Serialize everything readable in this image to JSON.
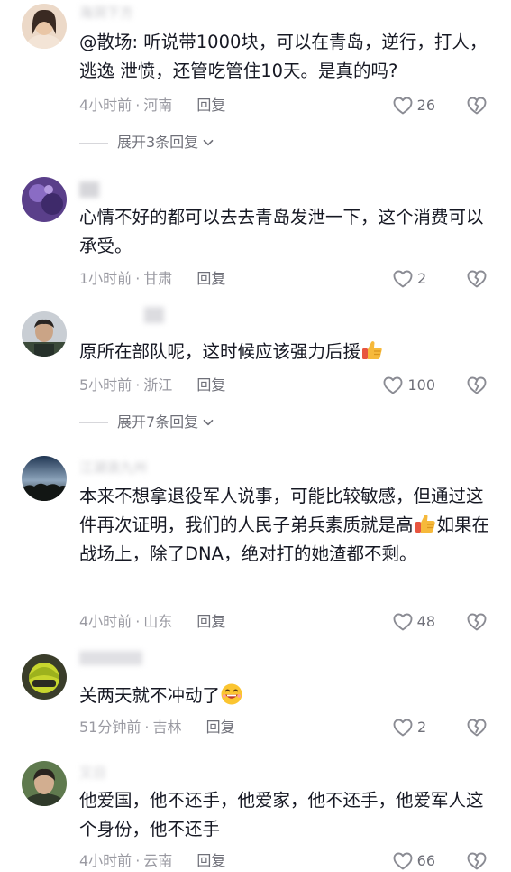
{
  "comments": [
    {
      "name": "海洞下方",
      "text": "@散场: 听说带1000块，可以在青岛，逆行，打人，逃逸 泄愤，还管吃管住10天。是真的吗?",
      "time": "4小时前",
      "location": "河南",
      "reply_label": "回复",
      "likes": "26",
      "expand_label": "展开3条回复"
    },
    {
      "name": "",
      "text": "心情不好的都可以去去青岛发泄一下，这个消费可以承受。",
      "time": "1小时前",
      "location": "甘肃",
      "reply_label": "回复",
      "likes": "2"
    },
    {
      "name": "",
      "text": "原所在部队呢，这时候应该强力后援",
      "time": "5小时前",
      "location": "浙江",
      "reply_label": "回复",
      "likes": "100",
      "expand_label": "展开7条回复"
    },
    {
      "name": "江湖浪九州",
      "text_before": "本来不想拿退役军人说事，可能比较敏感，但通过这件再次证明，我们的人民子弟兵素质就是高",
      "text_after": "如果在战场上，除了DNA，绝对打的她渣都不剩。",
      "time": "4小时前",
      "location": "山东",
      "reply_label": "回复",
      "likes": "48"
    },
    {
      "name": "",
      "text": "关两天就不冲动了",
      "time": "51分钟前",
      "location": "吉林",
      "reply_label": "回复",
      "likes": "2"
    },
    {
      "name": "又日",
      "text": "他爱国，他不还手，他爱家，他不还手，他爱军人这个身份，他不还手",
      "time": "4小时前",
      "location": "云南",
      "reply_label": "回复",
      "likes": "66"
    }
  ],
  "colors": {
    "text": "#161823",
    "meta": "#9a9aa2",
    "reply": "#6f7079",
    "icon": "#8a8b93"
  },
  "icons": {
    "like": "heart-outline-icon",
    "dislike": "broken-heart-icon",
    "expand": "chevron-down-icon",
    "emoji_thumb": "thumbs-up-emoji",
    "emoji_laugh": "grinning-emoji"
  }
}
